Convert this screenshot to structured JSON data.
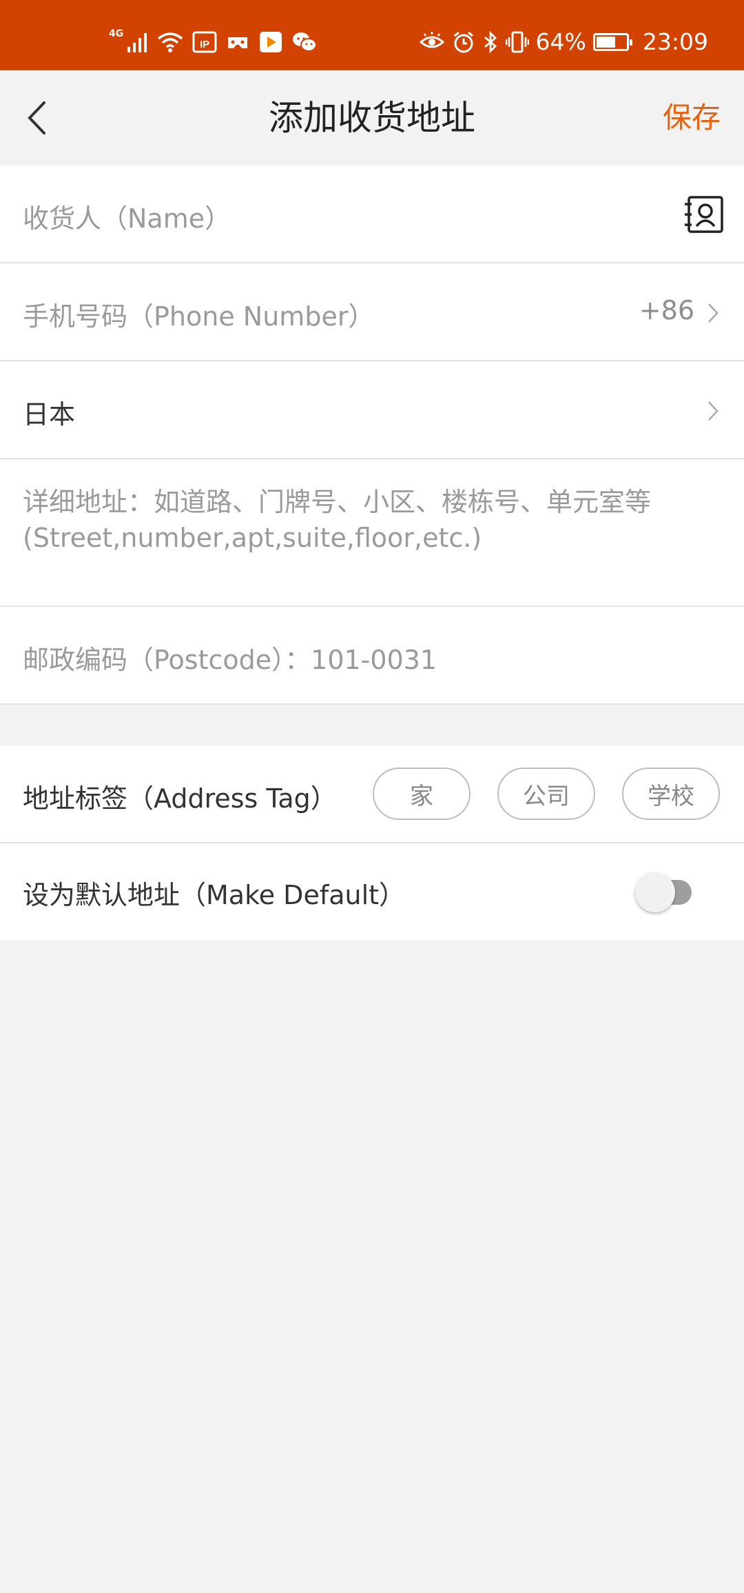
{
  "status_bar": {
    "network_tag": "4G",
    "battery_percent": "64%",
    "battery_level": 0.64,
    "time": "23:09",
    "colors": {
      "background": "#d24200"
    }
  },
  "header": {
    "title": "添加收货地址",
    "save_label": "保存",
    "back_icon": "chevron-left-icon",
    "accent_color": "#e8620f"
  },
  "form": {
    "name_placeholder": "收货人（Name）",
    "contacts_icon": "contacts-book-icon",
    "phone_placeholder": "手机号码（Phone Number）",
    "phone_prefix": "+86",
    "country": "日本",
    "address_placeholder": "详细地址：如道路、门牌号、小区、楼栋号、单元室等(Street,number,apt,suite,floor,etc.)",
    "postcode_placeholder": "邮政编码（Postcode）：101-0031"
  },
  "options": {
    "tag_label": "地址标签（Address Tag）",
    "tags": [
      "家",
      "公司",
      "学校"
    ],
    "default_label": "设为默认地址（Make Default）",
    "default_on": false
  }
}
